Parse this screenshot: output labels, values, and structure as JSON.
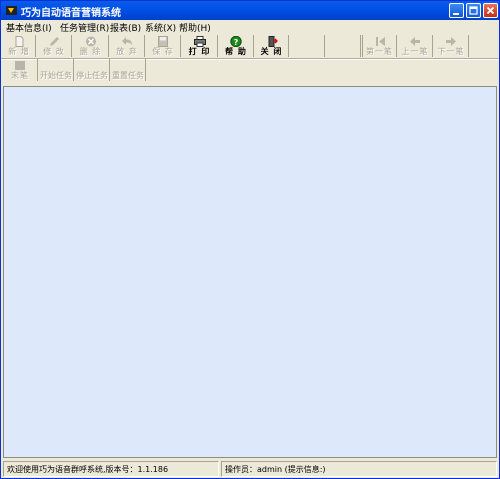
{
  "window": {
    "title": "巧为自动语音营销系统"
  },
  "menu": [
    "基本信息(I)",
    "任务管理(R)",
    "报表(B)",
    "系统(X)",
    "帮助(H)"
  ],
  "toolbar": {
    "row1": [
      {
        "label": "新 增",
        "icon": "new-doc-icon",
        "enabled": false
      },
      {
        "label": "修 改",
        "icon": "pencil-icon",
        "enabled": false
      },
      {
        "label": "删 除",
        "icon": "delete-icon",
        "enabled": false
      },
      {
        "label": "放 弃",
        "icon": "undo-icon",
        "enabled": false
      },
      {
        "label": "保 存",
        "icon": "save-icon",
        "enabled": false
      },
      {
        "label": "打 印",
        "icon": "printer-icon",
        "enabled": true
      },
      {
        "label": "帮 助",
        "icon": "help-icon",
        "enabled": true
      },
      {
        "label": "关 闭",
        "icon": "close-door-icon",
        "enabled": true
      },
      {
        "label": "",
        "icon": "",
        "enabled": false
      },
      {
        "label": "",
        "icon": "",
        "enabled": false
      },
      {
        "label": "第一笔",
        "icon": "first-record-icon",
        "enabled": false
      },
      {
        "label": "上一笔",
        "icon": "prev-record-icon",
        "enabled": false
      },
      {
        "label": "下一笔",
        "icon": "next-record-icon",
        "enabled": false
      }
    ],
    "row2": [
      {
        "label": "末笔",
        "icon": "last-record-icon",
        "enabled": false
      },
      {
        "label": "开始任务",
        "icon": "",
        "enabled": false
      },
      {
        "label": "停止任务",
        "icon": "",
        "enabled": false
      },
      {
        "label": "重置任务",
        "icon": "",
        "enabled": false
      }
    ]
  },
  "status": {
    "left": "欢迎使用巧为语音群呼系统,版本号：1.1.186",
    "right": "操作员：admin (提示信息:)"
  },
  "colors": {
    "titlebar": "#0054e3",
    "client_area": "#dde8fb",
    "chrome": "#ece9d8"
  }
}
